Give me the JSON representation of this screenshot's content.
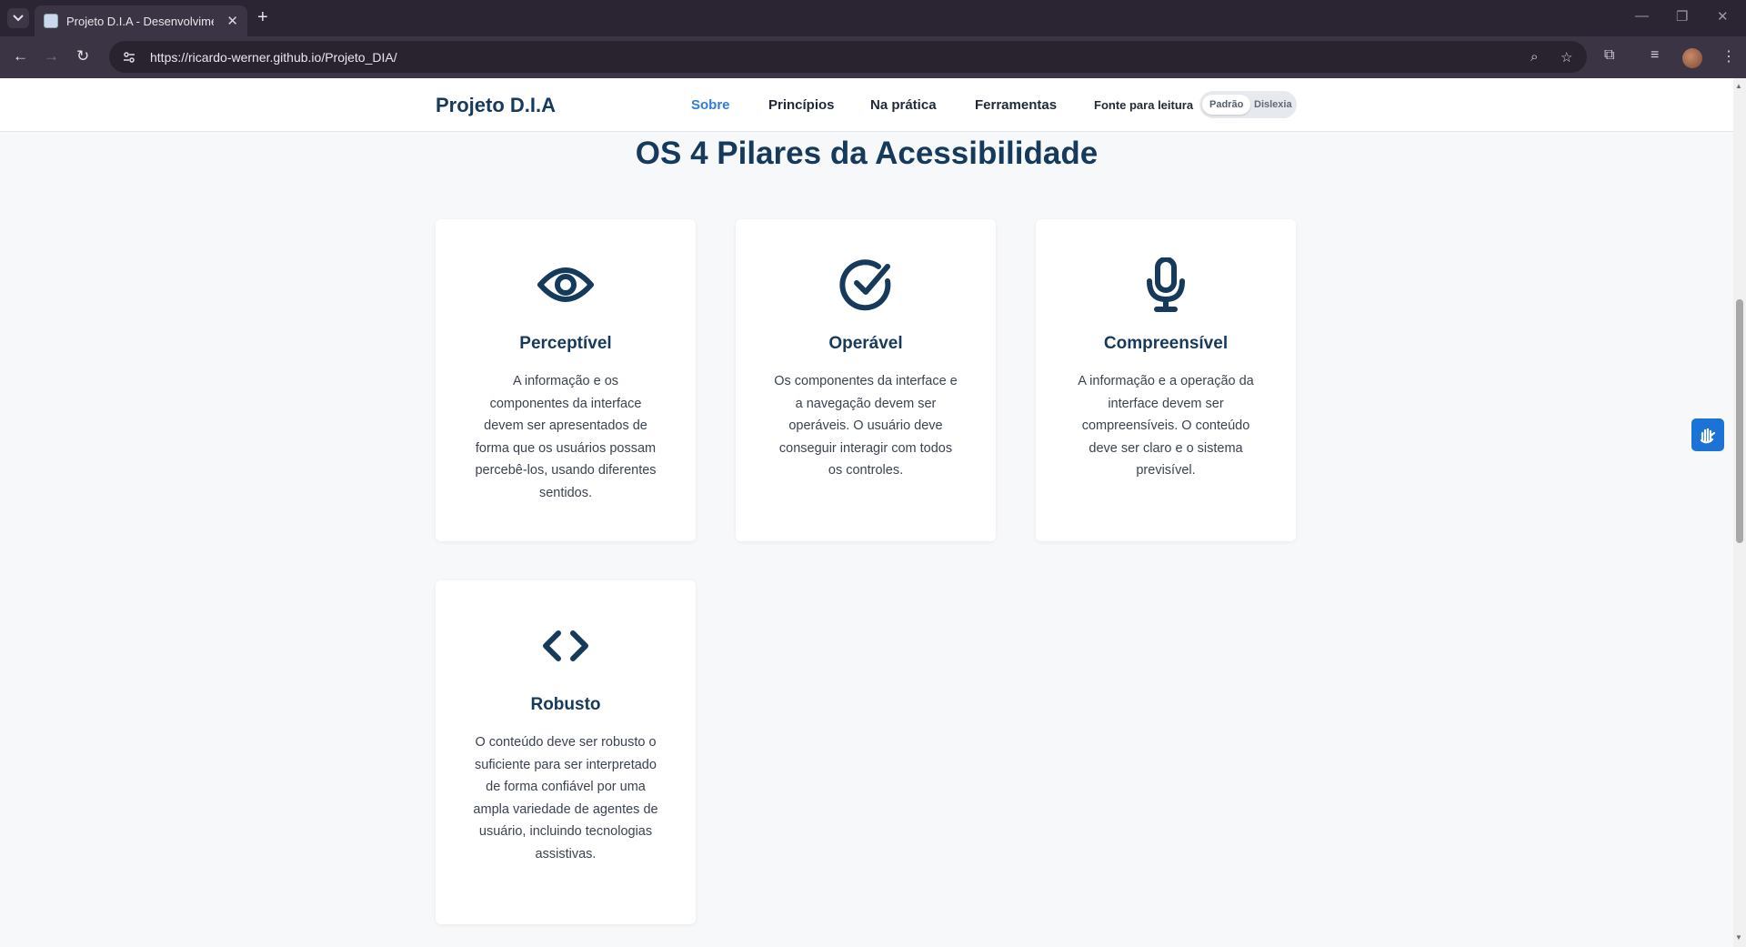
{
  "browser": {
    "tab_title": "Projeto D.I.A - Desenvolvimento",
    "tab_close": "✕",
    "new_tab": "+",
    "url": "https://ricardo-werner.github.io/Projeto_DIA/",
    "icons": [
      "tab-list-icon",
      "back-icon",
      "forward-icon",
      "reload-icon",
      "site-info-icon",
      "zoom-icon",
      "bookmark-star-icon",
      "extensions-icon",
      "media-controls-icon",
      "profile-avatar",
      "menu-icon"
    ]
  },
  "header": {
    "brand": "Projeto D.I.A",
    "nav": [
      {
        "label": "Sobre",
        "active": true
      },
      {
        "label": "Princípios",
        "active": false
      },
      {
        "label": "Na prática",
        "active": false
      },
      {
        "label": "Ferramentas",
        "active": false
      }
    ],
    "font_label": "Fonte para leitura",
    "font_options": [
      {
        "label": "Padrão",
        "selected": true
      },
      {
        "label": "Dislexia",
        "selected": false
      }
    ]
  },
  "section": {
    "title": "OS 4 Pilares da Acessibilidade"
  },
  "cards": [
    {
      "icon": "eye-icon",
      "title": "Perceptível",
      "text": "A informação e os componentes da interface devem ser apresentados de forma que os usuários possam percebê-los, usando diferentes sentidos."
    },
    {
      "icon": "check-circle-icon",
      "title": "Operável",
      "text": "Os componentes da interface e a navegação devem ser operáveis. O usuário deve conseguir interagir com todos os controles."
    },
    {
      "icon": "microphone-icon",
      "title": "Compreensível",
      "text": "A informação e a operação da interface devem ser compreensíveis. O conteúdo deve ser claro e o sistema previsível."
    },
    {
      "icon": "code-icon",
      "title": "Robusto",
      "text": "O conteúdo deve ser robusto o suficiente para ser interpretado de forma confiável por uma ampla variedade de agentes de usuário, incluindo tecnologias assistivas."
    }
  ],
  "colors": {
    "primary": "#163a5c",
    "link_active": "#2f7fd6",
    "accessibility_button": "#1b73d6"
  }
}
